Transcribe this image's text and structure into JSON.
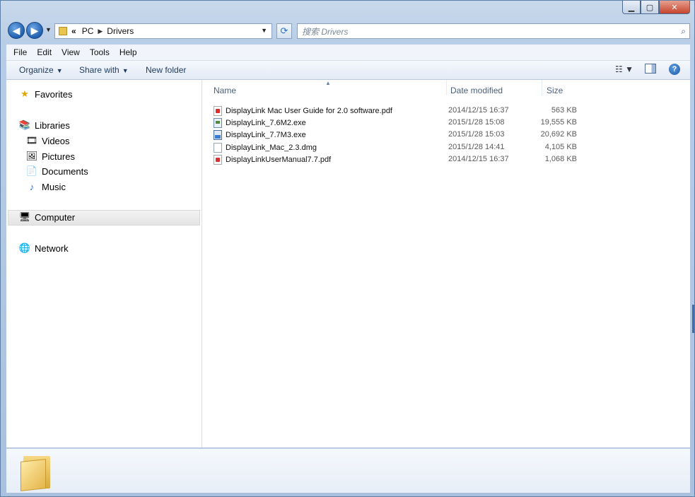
{
  "window": {
    "caption_buttons": {
      "minimize": "▁",
      "maximize": "▢",
      "close": "✕"
    }
  },
  "nav": {
    "back_glyph": "◀",
    "forward_glyph": "▶",
    "history_dropdown": "▼",
    "address": {
      "prefix": "«",
      "crumbs": [
        "PC",
        "Drivers"
      ],
      "separator": "▶",
      "dropdown": "▼"
    },
    "refresh_glyph": "⟳",
    "search": {
      "placeholder": "搜索 Drivers",
      "icon": "search-icon"
    }
  },
  "menu": {
    "items": [
      "File",
      "Edit",
      "View",
      "Tools",
      "Help"
    ]
  },
  "toolbar": {
    "organize": "Organize",
    "share_with": "Share with",
    "new_folder": "New folder",
    "dropdown": "▼",
    "views_glyph": "☷ ▼",
    "help_glyph": "?"
  },
  "sidebar": {
    "favorites": {
      "label": "Favorites",
      "icon": "star-icon",
      "glyph": "★"
    },
    "libraries": {
      "label": "Libraries",
      "icon": "libraries-icon",
      "glyph": "📚"
    },
    "library_items": [
      {
        "label": "Videos",
        "icon": "videos-icon",
        "glyph": "🎞"
      },
      {
        "label": "Pictures",
        "icon": "pictures-icon",
        "glyph": "🖼"
      },
      {
        "label": "Documents",
        "icon": "documents-icon",
        "glyph": "📄"
      },
      {
        "label": "Music",
        "icon": "music-icon",
        "glyph": "♪"
      }
    ],
    "computer": {
      "label": "Computer",
      "icon": "computer-icon",
      "glyph": "🖥",
      "selected": true
    },
    "network": {
      "label": "Network",
      "icon": "network-icon",
      "glyph": "🌐"
    }
  },
  "filelist": {
    "columns": {
      "name": "Name",
      "date": "Date modified",
      "size": "Size",
      "sort_caret": "▲"
    },
    "files": [
      {
        "name": "DisplayLink Mac User Guide for 2.0 software.pdf",
        "date": "2014/12/15 16:37",
        "size": "563 KB",
        "icon": "pdf"
      },
      {
        "name": "DisplayLink_7.6M2.exe",
        "date": "2015/1/28 15:08",
        "size": "19,555 KB",
        "icon": "exe"
      },
      {
        "name": "DisplayLink_7.7M3.exe",
        "date": "2015/1/28 15:03",
        "size": "20,692 KB",
        "icon": "setup"
      },
      {
        "name": "DisplayLink_Mac_2.3.dmg",
        "date": "2015/1/28 14:41",
        "size": "4,105 KB",
        "icon": "blank"
      },
      {
        "name": "DisplayLinkUserManual7.7.pdf",
        "date": "2014/12/15 16:37",
        "size": "1,068 KB",
        "icon": "pdf"
      }
    ]
  },
  "details": {
    "icon": "folder-large-icon"
  }
}
